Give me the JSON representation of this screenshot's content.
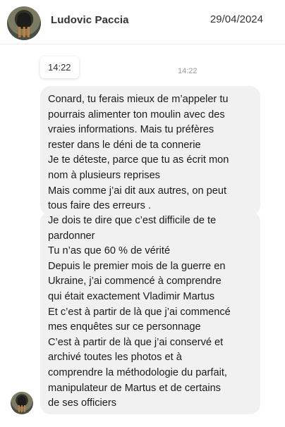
{
  "header": {
    "contact_name": "Ludovic Paccia",
    "date": "29/04/2024"
  },
  "timestamp_chip": "14:22",
  "timestamp_small": "14:22",
  "messages": [
    {
      "lines": [
        "Conard, tu ferais mieux de m’appeler tu",
        "pourrais alimenter ton moulin avec des",
        "vraies informations. Mais tu préfères",
        "rester dans le déni de ta connerie",
        "Je te déteste, parce que tu as écrit mon",
        "nom à plusieurs reprises",
        "Mais comme j’ai dit aux autres, on peut",
        "tous faire des erreurs ."
      ]
    },
    {
      "lines": [
        "Je dois te dire que c’est difficile de te",
        "pardonner",
        "Tu n’as que 60 % de vérité",
        "Depuis le premier mois de la guerre en",
        "Ukraine, j’ai commencé à comprendre",
        "qui était exactement Vladimir Martus",
        "Et c’est à partir de là que j’ai commencé",
        "mes enquêtes sur ce personnage",
        "C’est à partir de là que j’ai conservé et",
        "archivé toutes les photos et à",
        "comprendre la méthodologie du parfait,",
        "manipulateur de Martus et de certains",
        "de ses officiers"
      ]
    }
  ]
}
